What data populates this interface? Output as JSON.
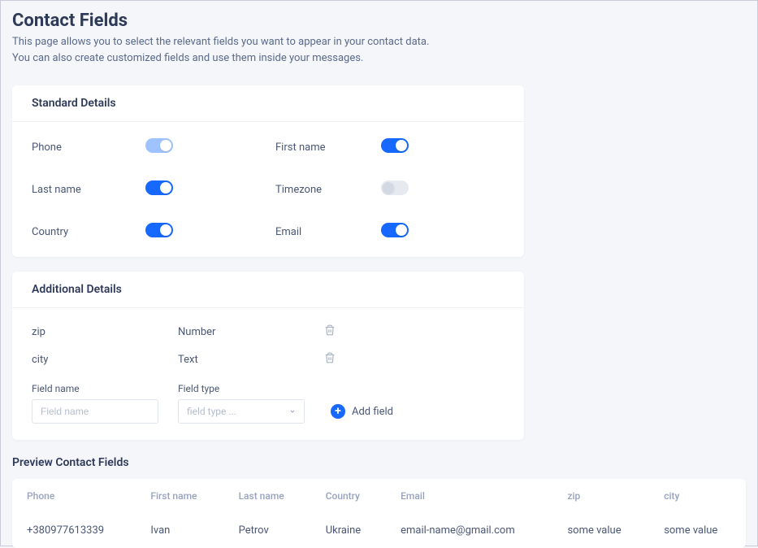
{
  "page": {
    "title": "Contact Fields",
    "desc_line1": "This page allows you to select the relevant fields you want to appear in your contact data.",
    "desc_line2": "You can also create customized fields and use them inside your messages."
  },
  "standard": {
    "header": "Standard Details",
    "fields": {
      "phone": {
        "label": "Phone",
        "on": true,
        "light": true
      },
      "first_name": {
        "label": "First name",
        "on": true,
        "light": false
      },
      "last_name": {
        "label": "Last name",
        "on": true,
        "light": false
      },
      "timezone": {
        "label": "Timezone",
        "on": false,
        "light": false
      },
      "country": {
        "label": "Country",
        "on": true,
        "light": false
      },
      "email": {
        "label": "Email",
        "on": true,
        "light": false
      }
    }
  },
  "additional": {
    "header": "Additional Details",
    "rows": [
      {
        "name": "zip",
        "type": "Number"
      },
      {
        "name": "city",
        "type": "Text"
      }
    ],
    "form": {
      "name_label": "Field name",
      "name_placeholder": "Field name",
      "type_label": "Field type",
      "type_placeholder": "field type ...",
      "add_label": "Add field"
    }
  },
  "preview": {
    "title": "Preview Contact Fields",
    "headers": [
      "Phone",
      "First name",
      "Last name",
      "Country",
      "Email",
      "zip",
      "city"
    ],
    "row": [
      "+380977613339",
      "Ivan",
      "Petrov",
      "Ukraine",
      "email-name@gmail.com",
      "some value",
      "some value"
    ]
  }
}
